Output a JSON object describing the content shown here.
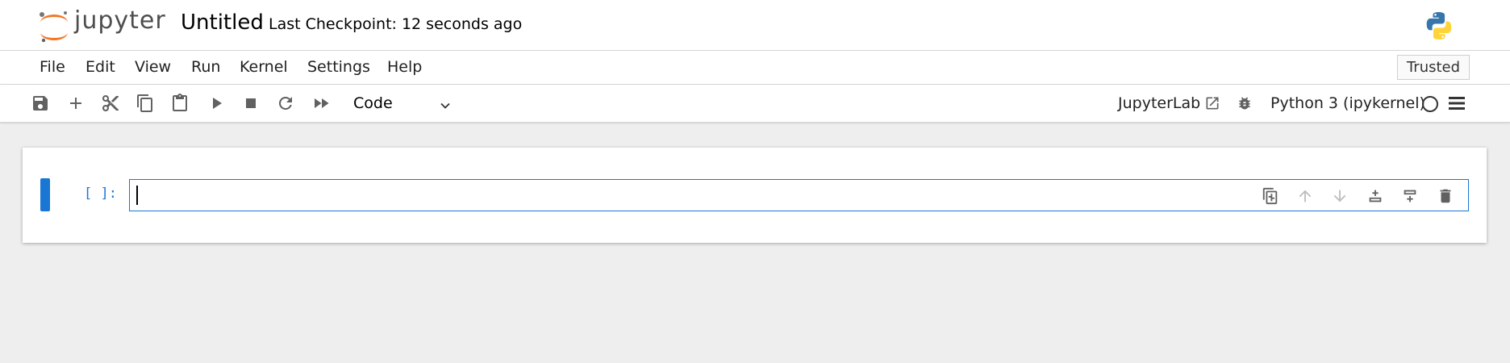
{
  "header": {
    "logo_text": "jupyter",
    "notebook_title": "Untitled",
    "checkpoint": "Last Checkpoint: 12 seconds ago",
    "kernel_logo_icon": "python-logo-icon"
  },
  "menubar": {
    "items": [
      {
        "label": "File"
      },
      {
        "label": "Edit"
      },
      {
        "label": "View"
      },
      {
        "label": "Run"
      },
      {
        "label": "Kernel"
      },
      {
        "label": "Settings"
      },
      {
        "label": "Help"
      }
    ],
    "trusted_label": "Trusted"
  },
  "toolbar": {
    "buttons": [
      {
        "icon": "save-icon"
      },
      {
        "icon": "plus-icon"
      },
      {
        "icon": "cut-icon"
      },
      {
        "icon": "copy-icon"
      },
      {
        "icon": "paste-icon"
      },
      {
        "icon": "run-icon"
      },
      {
        "icon": "stop-icon"
      },
      {
        "icon": "restart-icon"
      },
      {
        "icon": "fast-forward-icon"
      }
    ],
    "cell_type": "Code",
    "jupyterlab_link": "JupyterLab",
    "kernel_name": "Python 3 (ipykernel)",
    "kernel_status": "idle"
  },
  "cell": {
    "prompt": "[ ]:",
    "source": "",
    "toolbar_icons": [
      "duplicate-icon",
      "move-up-icon",
      "move-down-icon",
      "insert-above-icon",
      "insert-below-icon",
      "delete-icon"
    ]
  },
  "colors": {
    "accent": "#1976d2",
    "jupyter_orange": "#f37726",
    "background": "#eeeeee"
  }
}
